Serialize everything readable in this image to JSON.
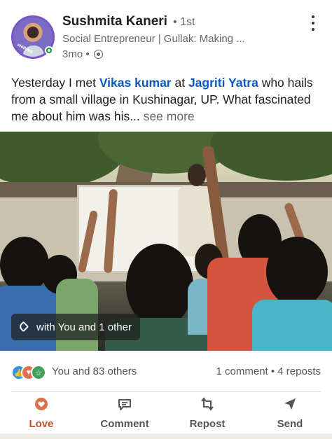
{
  "author": {
    "name": "Sushmita Kaneri",
    "degree": "• 1st",
    "headline": "Social Entrepreneur | Gullak: Making ...",
    "time": "3mo •",
    "avatar_badge": "#HIRING"
  },
  "post": {
    "text_before": "Yesterday I met ",
    "mention_1": "Vikas kumar",
    "text_between": " at ",
    "mention_2": "Jagriti Yatra",
    "text_after": "  who hails from a small village in Kushinagar, UP. What fascinated me about him was his... ",
    "see_more": "see more"
  },
  "photo": {
    "tag_label": "with You and 1 other"
  },
  "social": {
    "reactions_text": "You and 83 others",
    "engagement_text": "1 comment • 4 reposts",
    "reaction_icons": [
      "like-icon",
      "love-icon",
      "support-icon"
    ]
  },
  "actions": [
    {
      "label": "Love",
      "icon": "heart-icon",
      "active": true
    },
    {
      "label": "Comment",
      "icon": "comment-icon",
      "active": false
    },
    {
      "label": "Repost",
      "icon": "repost-icon",
      "active": false
    },
    {
      "label": "Send",
      "icon": "send-icon",
      "active": false
    }
  ],
  "colors": {
    "mention": "#0a58c2",
    "love_active": "#c0512a",
    "like": "#378fe9",
    "love": "#df704d",
    "support": "#44a25a"
  }
}
